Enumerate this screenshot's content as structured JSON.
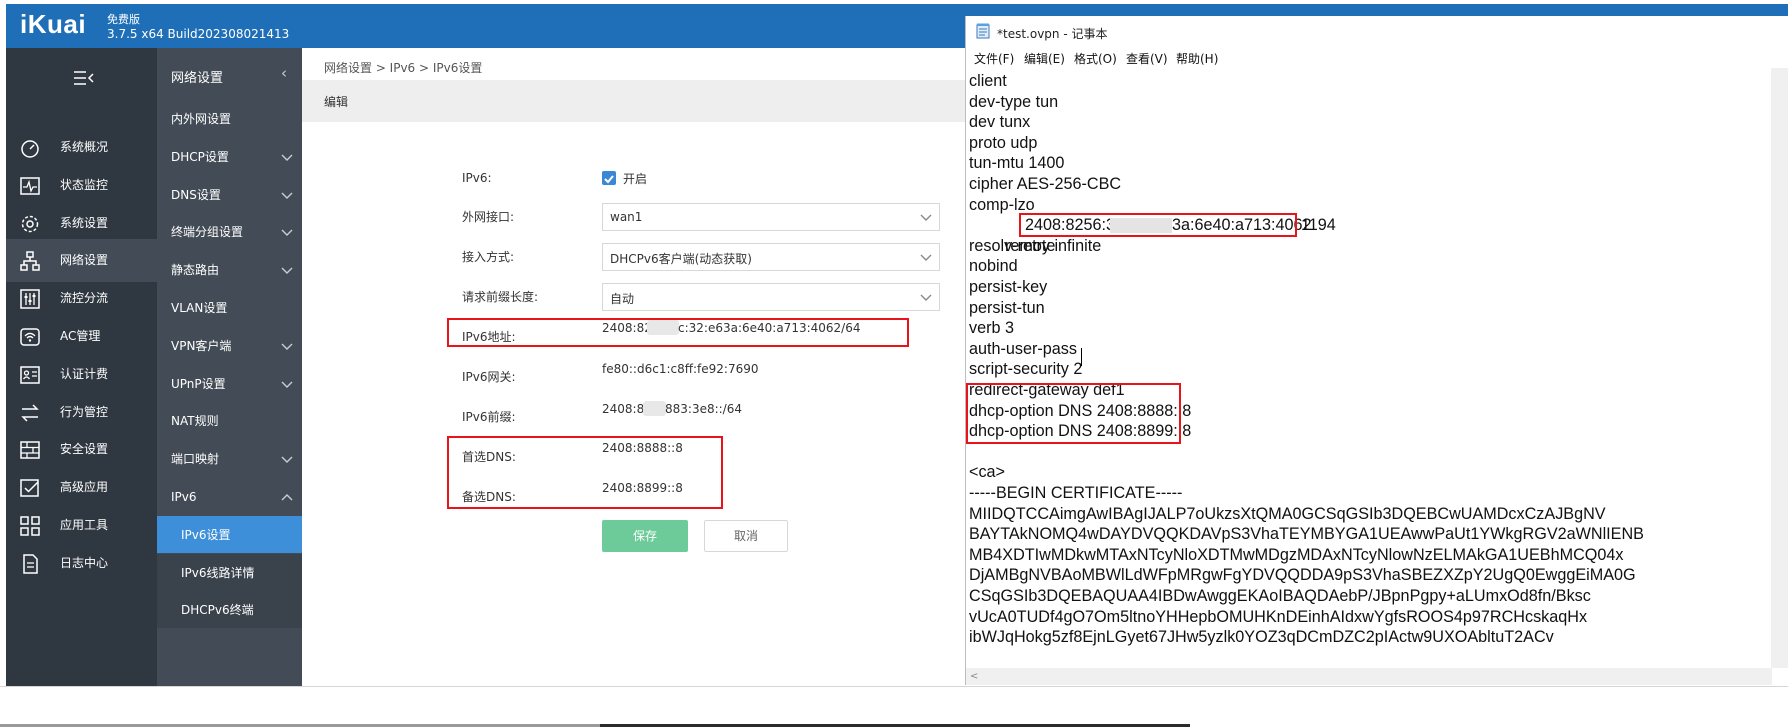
{
  "router": {
    "logo": "iKuai",
    "edition": "免费版",
    "build": "3.7.5 x64 Build202308021413",
    "nav_primary": [
      {
        "label": "系统概况",
        "icon": "dashboard-icon"
      },
      {
        "label": "状态监控",
        "icon": "pulse-monitor-icon"
      },
      {
        "label": "系统设置",
        "icon": "gear-icon"
      },
      {
        "label": "网络设置",
        "icon": "network-tree-icon",
        "active": true
      },
      {
        "label": "流控分流",
        "icon": "sliders-icon"
      },
      {
        "label": "AC管理",
        "icon": "wifi-ap-icon"
      },
      {
        "label": "认证计费",
        "icon": "id-card-icon"
      },
      {
        "label": "行为管控",
        "icon": "swap-arrows-icon"
      },
      {
        "label": "安全设置",
        "icon": "firewall-grid-icon"
      },
      {
        "label": "高级应用",
        "icon": "checkbox-app-icon"
      },
      {
        "label": "应用工具",
        "icon": "app-grid-icon"
      },
      {
        "label": "日志中心",
        "icon": "document-icon"
      }
    ],
    "nav_secondary_title": "网络设置",
    "nav_secondary": [
      {
        "label": "内外网设置",
        "expand": false
      },
      {
        "label": "DHCP设置",
        "expand": true
      },
      {
        "label": "DNS设置",
        "expand": true
      },
      {
        "label": "终端分组设置",
        "expand": true
      },
      {
        "label": "静态路由",
        "expand": true
      },
      {
        "label": "VLAN设置",
        "expand": false
      },
      {
        "label": "VPN客户端",
        "expand": true
      },
      {
        "label": "UPnP设置",
        "expand": true
      },
      {
        "label": "NAT规则",
        "expand": false
      },
      {
        "label": "端口映射",
        "expand": true
      },
      {
        "label": "IPv6",
        "expand": true,
        "open": true
      },
      {
        "label": "IPv6设置",
        "sub": true,
        "selected": true
      },
      {
        "label": "IPv6线路详情",
        "sub": true
      },
      {
        "label": "DHCPv6终端",
        "sub": true
      }
    ],
    "breadcrumb": "网络设置 > IPv6 > IPv6设置",
    "edit_title": "编辑",
    "form": {
      "ipv6_label": "IPv6:",
      "ipv6_enable_label": "开启",
      "ipv6_enabled": true,
      "wan_label": "外网接口:",
      "wan_value": "wan1",
      "access_label": "接入方式:",
      "access_value": "DHCPv6客户端(动态获取)",
      "prefix_len_label": "请求前缀长度:",
      "prefix_len_value": "自动",
      "addr_label": "IPv6地址:",
      "addr_prefix": "2408:82",
      "addr_suffix": "c:32:e63a:6e40:a713:4062/64",
      "gw_label": "IPv6网关:",
      "gw_value": "fe80::d6c1:c8ff:fe92:7690",
      "pfx_label": "IPv6前缀:",
      "pfx_prefix": "2408:8",
      "pfx_suffix": "883:3e8::/64",
      "dns1_label": "首选DNS:",
      "dns1_value": "2408:8888::8",
      "dns2_label": "备选DNS:",
      "dns2_value": "2408:8899::8",
      "save_label": "保存",
      "cancel_label": "取消"
    }
  },
  "notepad": {
    "title": "*test.ovpn - 记事本",
    "menu": [
      "文件(F)",
      "编辑(E)",
      "格式(O)",
      "查看(V)",
      "帮助(H)"
    ],
    "lines": [
      "client",
      "dev-type tun",
      "dev tunx",
      "proto udp",
      "tun-mtu 1400",
      "cipher AES-256-CBC",
      "comp-lzo",
      "",
      "resolv-retry infinite",
      "nobind",
      "persist-key",
      "persist-tun",
      "verb 3",
      "auth-user-pass",
      "script-security 2",
      "redirect-gateway def1",
      "dhcp-option DNS 2408:8888::8",
      "dhcp-option DNS 2408:8899::8",
      "",
      "<ca>",
      "-----BEGIN CERTIFICATE-----",
      "MIIDQTCCAimgAwIBAgIJALP7oUkzsXtQMA0GCSqGSIb3DQEBCwUAMDcxCzAJBgNV",
      "BAYTAkNOMQ4wDAYDVQQKDAVpS3VhaTEYMBYGA1UEAwwPaUt1YWkgRGV2aWNlIENB",
      "MB4XDTIwMDkwMTAxNTcyNloXDTMwMDgzMDAxNTcyNlowNzELMAkGA1UEBhMCQ04x",
      "DjAMBgNVBAoMBWlLdWFpMRgwFgYDVQQDDA9pS3VhaSBEZXZpY2UgQ0EwggEiMA0G",
      "CSqGSIb3DQEBAQUAA4IBDwAwggEKAoIBAQDAebP/JBpnPgpy+aLUmxOd8fn/Bksc",
      "vUcA0TUDf4gO7Om5ltnoYHHepbOMUHKnDEinhAIdxwYgfsROOS4p97RCHcskaqHx",
      "ibWJqHokg5zf8EjnLGyet67JHw5yzlk0YOZ3qDCmDZC2pIActw9UXOAbltuT2ACv"
    ],
    "remote_label": "remote",
    "remote_addr_start": "2408:8256:3",
    "remote_addr_end": "3a:6e40:a713:4062",
    "remote_port": "1194",
    "hscroll_arrow": "<"
  }
}
